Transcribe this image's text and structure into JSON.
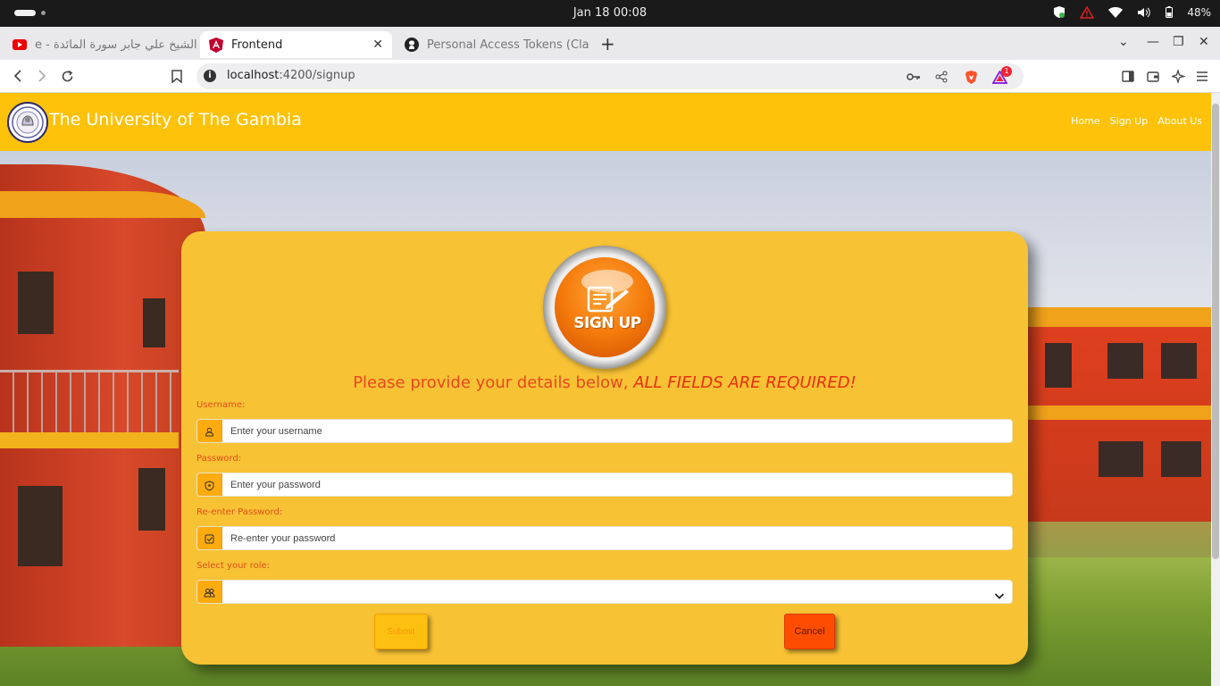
{
  "os": {
    "clock": "Jan 18  00:08",
    "battery": "48%"
  },
  "browser": {
    "tabs": [
      {
        "title": "الشيخ علي جابر سورة المائدة - e",
        "active": false,
        "icon": "youtube-icon"
      },
      {
        "title": "Frontend",
        "active": true,
        "icon": "angular-icon"
      },
      {
        "title": "Personal Access Tokens (Cla",
        "active": false,
        "icon": "github-icon"
      }
    ],
    "url_host": "localhost",
    "url_path": ":4200/signup",
    "brave_badge": "1"
  },
  "navbar": {
    "title": "The University of The Gambia",
    "links": [
      "Home",
      "Sign Up",
      "About Us"
    ]
  },
  "form": {
    "badge_text": "SIGN UP",
    "heading_plain": "Please provide your details below, ",
    "heading_emphasis": "ALL FIELDS ARE REQUIRED!",
    "fields": [
      {
        "label": "Username:",
        "placeholder": "Enter your username",
        "icon": "user-icon"
      },
      {
        "label": "Password:",
        "placeholder": "Enter your password",
        "icon": "shield-icon"
      },
      {
        "label": "Re-enter Password:",
        "placeholder": "Re-enter your password",
        "icon": "check-square-icon"
      },
      {
        "label": "Select your role:",
        "value": "",
        "icon": "users-icon"
      }
    ],
    "submit_label": "Submit",
    "cancel_label": "Cancel"
  },
  "colors": {
    "navbar": "#fdc209",
    "card": "#f8c235",
    "label": "#e24f17",
    "cancel": "#ff4d00"
  }
}
